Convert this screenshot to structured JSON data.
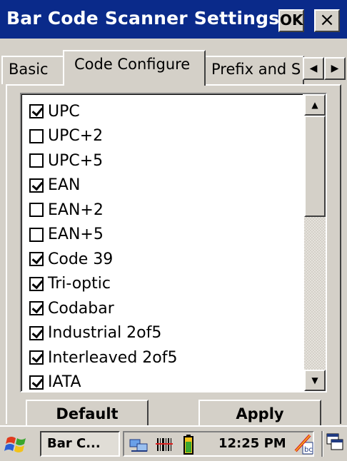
{
  "window": {
    "title": "Bar Code Scanner Settings",
    "ok_label": "OK",
    "close_glyph": "×"
  },
  "tabs": [
    {
      "label": "Basic",
      "selected": false
    },
    {
      "label": "Code Configure",
      "selected": true
    },
    {
      "label": "Prefix and S",
      "selected": false
    }
  ],
  "tab_scroll": {
    "left_glyph": "◀",
    "right_glyph": "▶"
  },
  "symbologies": [
    {
      "label": "UPC",
      "checked": true
    },
    {
      "label": "UPC+2",
      "checked": false
    },
    {
      "label": "UPC+5",
      "checked": false
    },
    {
      "label": "EAN",
      "checked": true
    },
    {
      "label": "EAN+2",
      "checked": false
    },
    {
      "label": "EAN+5",
      "checked": false
    },
    {
      "label": "Code 39",
      "checked": true
    },
    {
      "label": "Tri-optic",
      "checked": true
    },
    {
      "label": "Codabar",
      "checked": true
    },
    {
      "label": "Industrial 2of5",
      "checked": true
    },
    {
      "label": "Interleaved 2of5",
      "checked": true
    },
    {
      "label": "IATA",
      "checked": true
    }
  ],
  "scrollbar": {
    "up_glyph": "▲",
    "down_glyph": "▼"
  },
  "buttons": {
    "default_label": "Default",
    "apply_label": "Apply"
  },
  "taskbar": {
    "task_label": "Bar C...",
    "clock": "12:25 PM",
    "icons": [
      "start-flag-icon",
      "network-icon",
      "barcode-icon",
      "battery-icon",
      "input-panel-icon",
      "switch-windows-icon"
    ]
  },
  "colors": {
    "titlebar": "#0a2a8a",
    "face": "#d4d0c8",
    "text": "#000000"
  }
}
